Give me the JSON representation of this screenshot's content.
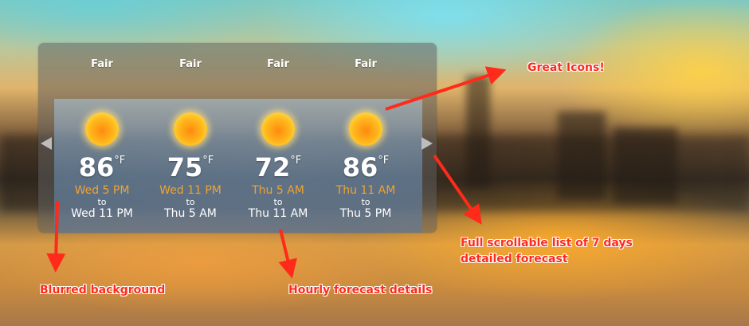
{
  "forecast": [
    {
      "condition": "Fair",
      "icon": "sun-icon",
      "temp": "86",
      "unit": "°F",
      "start": "Wed 5 PM",
      "to": "to",
      "end": "Wed 11 PM"
    },
    {
      "condition": "Fair",
      "icon": "sun-icon",
      "temp": "75",
      "unit": "°F",
      "start": "Wed 11 PM",
      "to": "to",
      "end": "Thu 5 AM"
    },
    {
      "condition": "Fair",
      "icon": "sun-icon",
      "temp": "72",
      "unit": "°F",
      "start": "Thu 5 AM",
      "to": "to",
      "end": "Thu 11 AM"
    },
    {
      "condition": "Fair",
      "icon": "sun-icon",
      "temp": "86",
      "unit": "°F",
      "start": "Thu 11 AM",
      "to": "to",
      "end": "Thu 5 PM"
    }
  ],
  "nav": {
    "prev_icon": "arrow-left-icon",
    "next_icon": "arrow-right-icon"
  },
  "annotations": {
    "icons": "Great Icons!",
    "scroll_line1": "Full scrollable list of 7 days",
    "scroll_line2": "detailed forecast",
    "blur": "Blurred background",
    "hourly": "Hourly forecast details"
  },
  "colors": {
    "time_accent": "#f0a235",
    "annotation_red": "#ff2a1a"
  }
}
